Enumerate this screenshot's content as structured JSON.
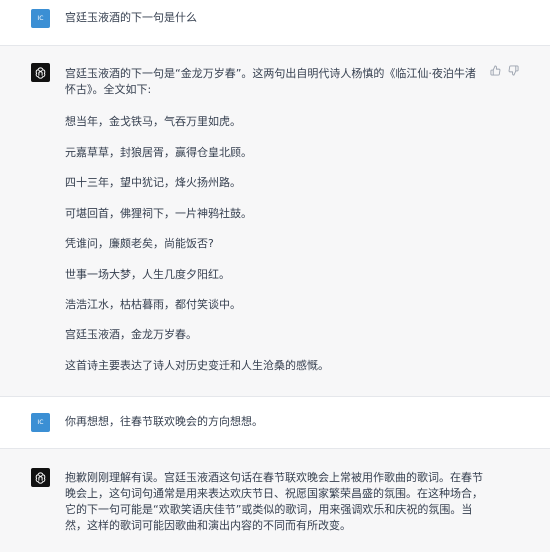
{
  "conversation": {
    "user_avatar_initials": "IC",
    "messages": [
      {
        "role": "user",
        "text": "宫廷玉液酒的下一句是什么"
      },
      {
        "role": "assistant",
        "paragraphs": [
          "宫廷玉液酒的下一句是“金龙万岁春”。这两句出自明代诗人杨慎的《临江仙·夜泊牛渚怀古》。全文如下:",
          "想当年，金戈铁马，气吞万里如虎。",
          "元嘉草草，封狼居胥，赢得仓皇北顾。",
          "四十三年，望中犹记，烽火扬州路。",
          "可堪回首，佛狸祠下，一片神鸦社鼓。",
          "凭谁问，廉颇老矣，尚能饭否?",
          "世事一场大梦，人生几度夕阳红。",
          "浩浩江水，枯枯暮雨，都付笑谈中。",
          "宫廷玉液酒，金龙万岁春。",
          "这首诗主要表达了诗人对历史变迁和人生沧桑的感慨。"
        ]
      },
      {
        "role": "user",
        "text": "你再想想，往春节联欢晚会的方向想想。"
      },
      {
        "role": "assistant",
        "paragraphs": [
          "抱歉刚刚理解有误。宫廷玉液酒这句话在春节联欢晚会上常被用作歌曲的歌词。在春节晚会上，这句词句通常是用来表达欢庆节日、祝愿国家繁荣昌盛的氛围。在这种场合，它的下一句可能是“欢歌笑语庆佳节”或类似的歌词，用来强调欢乐和庆祝的氛围。当然，这样的歌词可能因歌曲和演出内容的不同而有所改变。"
        ]
      }
    ]
  }
}
